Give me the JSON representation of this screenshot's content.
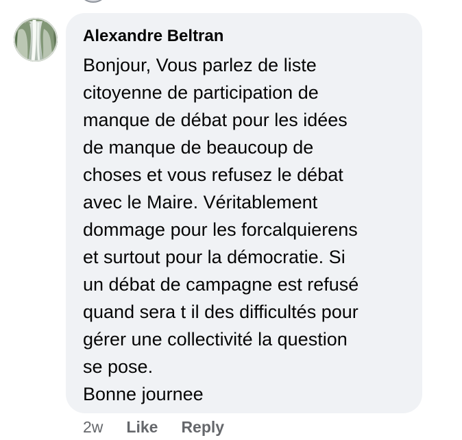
{
  "comment": {
    "author": "Alexandre Beltran",
    "avatar_icon": "profile-photo-waterfall",
    "lines": [
      "Bonjour, Vous parlez de liste",
      "citoyenne de participation de",
      "manque de débat pour les idées",
      "de manque de beaucoup de",
      "choses et vous refusez le débat",
      "avec le Maire. Véritablement",
      "dommage pour les forcalquierens",
      "et surtout pour la démocratie. Si",
      "un débat de campagne est refusé",
      "quand sera t il des difficultés pour",
      "gérer une collectivité la question",
      "se pose.",
      "Bonne journee"
    ],
    "timestamp": "2w",
    "like_label": "Like",
    "reply_label": "Reply",
    "colors": {
      "bubble_background": "#f0f2f5",
      "text": "#050505",
      "secondary_text": "#65676b"
    }
  }
}
